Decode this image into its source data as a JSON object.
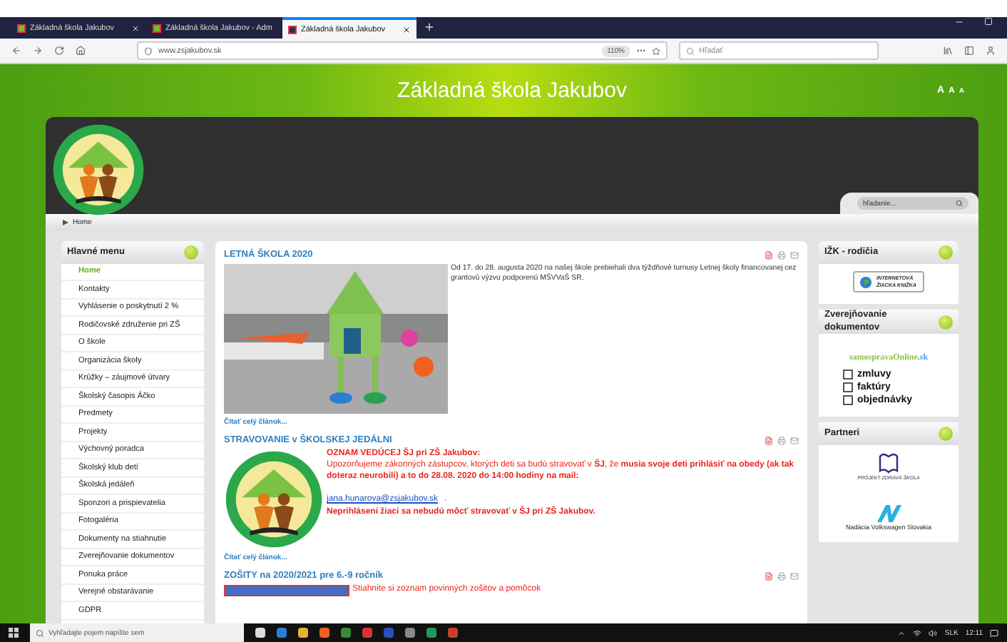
{
  "browser": {
    "tabs": [
      {
        "title": "Základná škola Jakubov",
        "selected": false
      },
      {
        "title": "Základná škola Jakubov - Adm",
        "selected": false
      },
      {
        "title": "Základná škola Jakubov",
        "selected": true
      }
    ],
    "url": "www.zsjakubov.sk",
    "zoom": "110%",
    "search": {
      "placeholder": "Hľadať"
    }
  },
  "page": {
    "title": "Základná škola Jakubov",
    "font_sizes": [
      "A",
      "A",
      "A"
    ],
    "search": {
      "placeholder": "hľadanie..."
    },
    "breadcrumb": "Home"
  },
  "menu": {
    "title": "Hlavné menu",
    "items": [
      {
        "label": "Home",
        "selected": true
      },
      {
        "label": "Kontakty",
        "selected": false
      },
      {
        "label": "Vyhlásenie o poskytnutí 2 %",
        "selected": false
      },
      {
        "label": "Rodičovské združenie pri ZŠ",
        "selected": false
      },
      {
        "label": "O škole",
        "selected": false
      },
      {
        "label": "Organizácia školy",
        "selected": false
      },
      {
        "label": "Krúžky – záujmové útvary",
        "selected": false
      },
      {
        "label": "Školský časopis Áčko",
        "selected": false
      },
      {
        "label": "Predmety",
        "selected": false
      },
      {
        "label": "Projekty",
        "selected": false
      },
      {
        "label": "Výchovný poradca",
        "selected": false
      },
      {
        "label": "Školský klub detí",
        "selected": false
      },
      {
        "label": "Školská jedáleň",
        "selected": false
      },
      {
        "label": "Sponzori a prispievatelia",
        "selected": false
      },
      {
        "label": "Fotogaléria",
        "selected": false
      },
      {
        "label": "Dokumenty na stiahnutie",
        "selected": false
      },
      {
        "label": "Zverejňovanie dokumentov",
        "selected": false
      },
      {
        "label": "Ponuka práce",
        "selected": false
      },
      {
        "label": "Verejné obstarávanie",
        "selected": false
      },
      {
        "label": "GDPR",
        "selected": false
      }
    ]
  },
  "articles": [
    {
      "title": "LETNÁ ŠKOLA 2020",
      "paragraphs": [
        "Od 17. do 28. augusta 2020 na našej škole prebiehali dva týždňové turnusy Letnej školy financovanej cez grantovú výzvu podporenú MŠVVaŠ SR."
      ],
      "read_more": "Čítať celý článok..."
    },
    {
      "kind": "logo",
      "title": "STRAVOVANIE v ŠKOLSKEJ JEDÁLNI",
      "paragraphs": [
        "**OZNAM VEDÚCEJ ŠJ pri ZŠ Jakubov:**",
        "Upozorňujeme zákonných zástupcov, ktorých deti sa budú stravovať v **ŠJ**, že **musia svoje deti prihlásiť na obedy (ak tak doteraz neurobili) a to do 28.08. 2020 do 14:00 hodiny na mail:**"
      ],
      "link": "jana.hunarova@zsjakubov.sk",
      "after_link": ".",
      "closing": "Neprihlásení žiaci sa nebudú môcť stravovať v ŠJ pri ZŠ Jakubov.",
      "read_more": "Čítať celý článok..."
    },
    {
      "kind": "banner",
      "title": "ZOŠITY na 2020/2021 pre 6.-9 ročník",
      "paragraphs": [
        "Stiahnite si zoznam povinných zošitov a pomôcok"
      ]
    }
  ],
  "sidebar": [
    {
      "kind": "izk",
      "title": "IŽK - rodičia",
      "lines": [
        "INTERNETOVÁ",
        "ŽIACKA KNIŽKA"
      ]
    },
    {
      "kind": "documents",
      "title": "Zverejňovanie dokumentov",
      "brand": [
        "samospravaOnline",
        ".sk"
      ],
      "options": [
        {
          "label": "zmluvy",
          "checked": false
        },
        {
          "label": "faktúry",
          "checked": false
        },
        {
          "label": "objednávky",
          "checked": false
        }
      ]
    },
    {
      "kind": "partners",
      "title": "Partneri",
      "partners": [
        {
          "kind": "book",
          "lines": [
            "PROJEKT",
            "ZDRAVÁ ŠKOLA"
          ]
        },
        {
          "kind": "foundation",
          "lines": [
            "Nadácia Volkswagen Slovakia"
          ]
        }
      ]
    }
  ],
  "taskbar": {
    "search": {
      "placeholder": "Vyhľadajte pojem napíšte sem"
    },
    "language": "SLK",
    "time": "12:11"
  }
}
